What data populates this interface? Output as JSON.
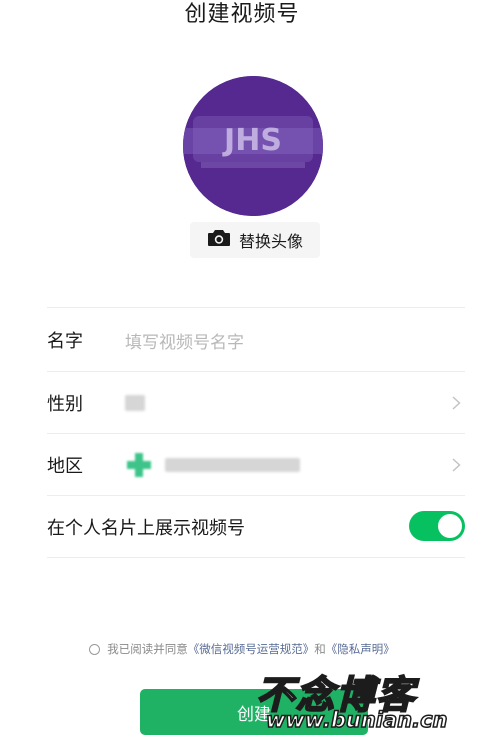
{
  "header": {
    "title": "创建视频号"
  },
  "avatar": {
    "text": "JHS"
  },
  "replace_avatar": {
    "label": "替换头像",
    "icon": "camera-icon"
  },
  "form": {
    "name": {
      "label": "名字",
      "placeholder": "填写视频号名字"
    },
    "gender": {
      "label": "性别"
    },
    "region": {
      "label": "地区"
    },
    "show_on_card": {
      "label": "在个人名片上展示视频号",
      "enabled": true
    }
  },
  "agreement": {
    "prefix": "我已阅读并同意",
    "link1": "《微信视频号运营规范》",
    "connector": "和",
    "link2": "《隐私声明》",
    "checked": false
  },
  "actions": {
    "create_label": "创建"
  },
  "watermark": {
    "title": "不念博客",
    "url": "www.bunian.cn"
  },
  "colors": {
    "accent_green": "#07c160",
    "button_green": "#1fb265",
    "link_blue": "#576b95",
    "avatar_purple": "#552990"
  }
}
